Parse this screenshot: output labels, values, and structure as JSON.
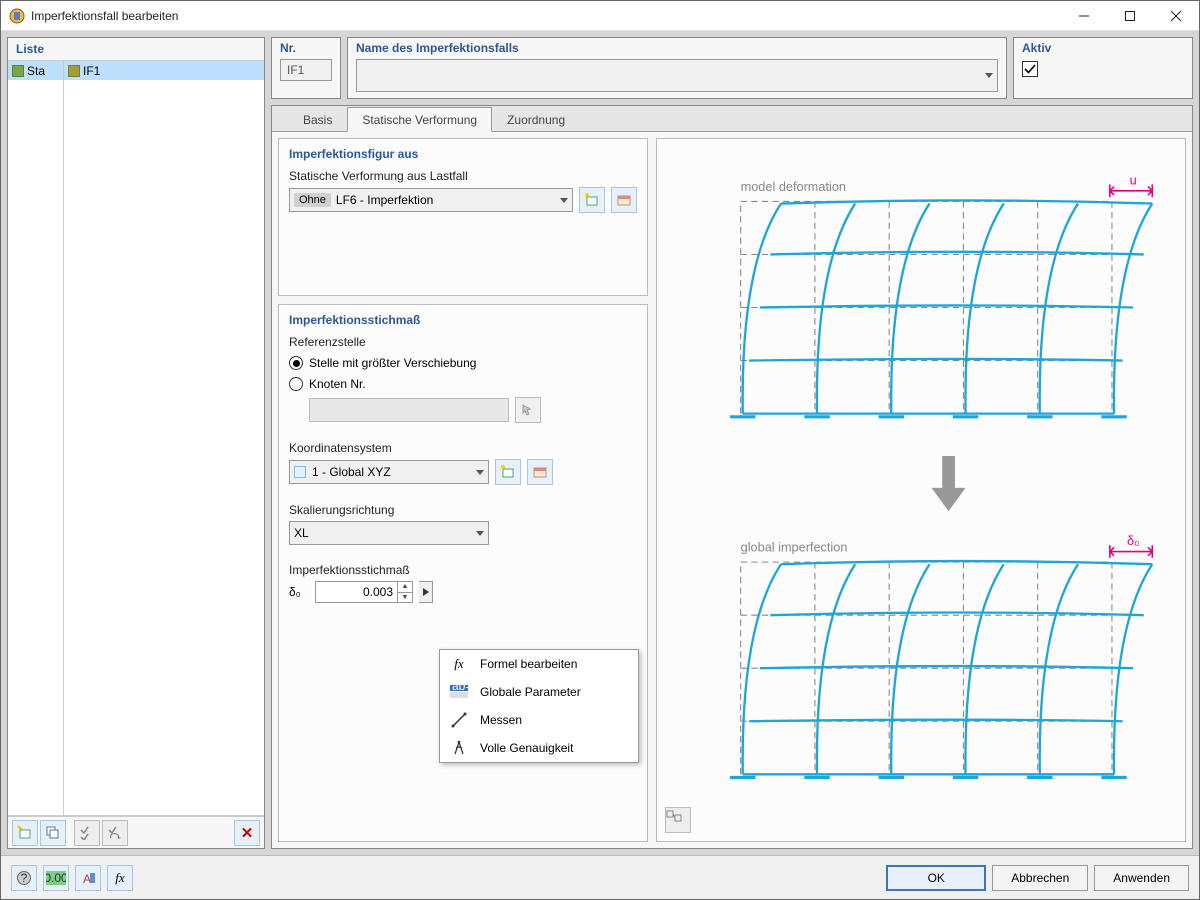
{
  "window": {
    "title": "Imperfektionsfall bearbeiten"
  },
  "left": {
    "header": "Liste",
    "rowA": "Sta",
    "rowB": "IF1"
  },
  "top": {
    "nr_label": "Nr.",
    "nr_value": "IF1",
    "name_label": "Name des Imperfektionsfalls",
    "name_value": "",
    "aktiv_label": "Aktiv"
  },
  "tabs": {
    "basis": "Basis",
    "statische": "Statische Verformung",
    "zuordnung": "Zuordnung"
  },
  "sec1": {
    "title": "Imperfektionsfigur aus",
    "lastfall_label": "Statische Verformung aus Lastfall",
    "lastfall_tag": "Ohne",
    "lastfall_value": "LF6 - Imperfektion"
  },
  "sec2": {
    "title": "Imperfektionsstichmaß",
    "ref_label": "Referenzstelle",
    "ref_opt1": "Stelle mit größter Verschiebung",
    "ref_opt2": "Knoten Nr.",
    "koord_label": "Koordinatensystem",
    "koord_value": "1 - Global XYZ",
    "skal_label": "Skalierungsrichtung",
    "skal_value": "XL",
    "stich_label": "Imperfektionsstichmaß",
    "delta_label": "δ₀",
    "delta_value": "0.003"
  },
  "preview": {
    "top_label": "model deformation",
    "top_sym": "u",
    "bot_label": "global imperfection",
    "bot_sym": "δ₀"
  },
  "ctx": {
    "formel": "Formel bearbeiten",
    "global": "Globale Parameter",
    "messen": "Messen",
    "volle": "Volle Genauigkeit"
  },
  "buttons": {
    "ok": "OK",
    "cancel": "Abbrechen",
    "apply": "Anwenden"
  }
}
